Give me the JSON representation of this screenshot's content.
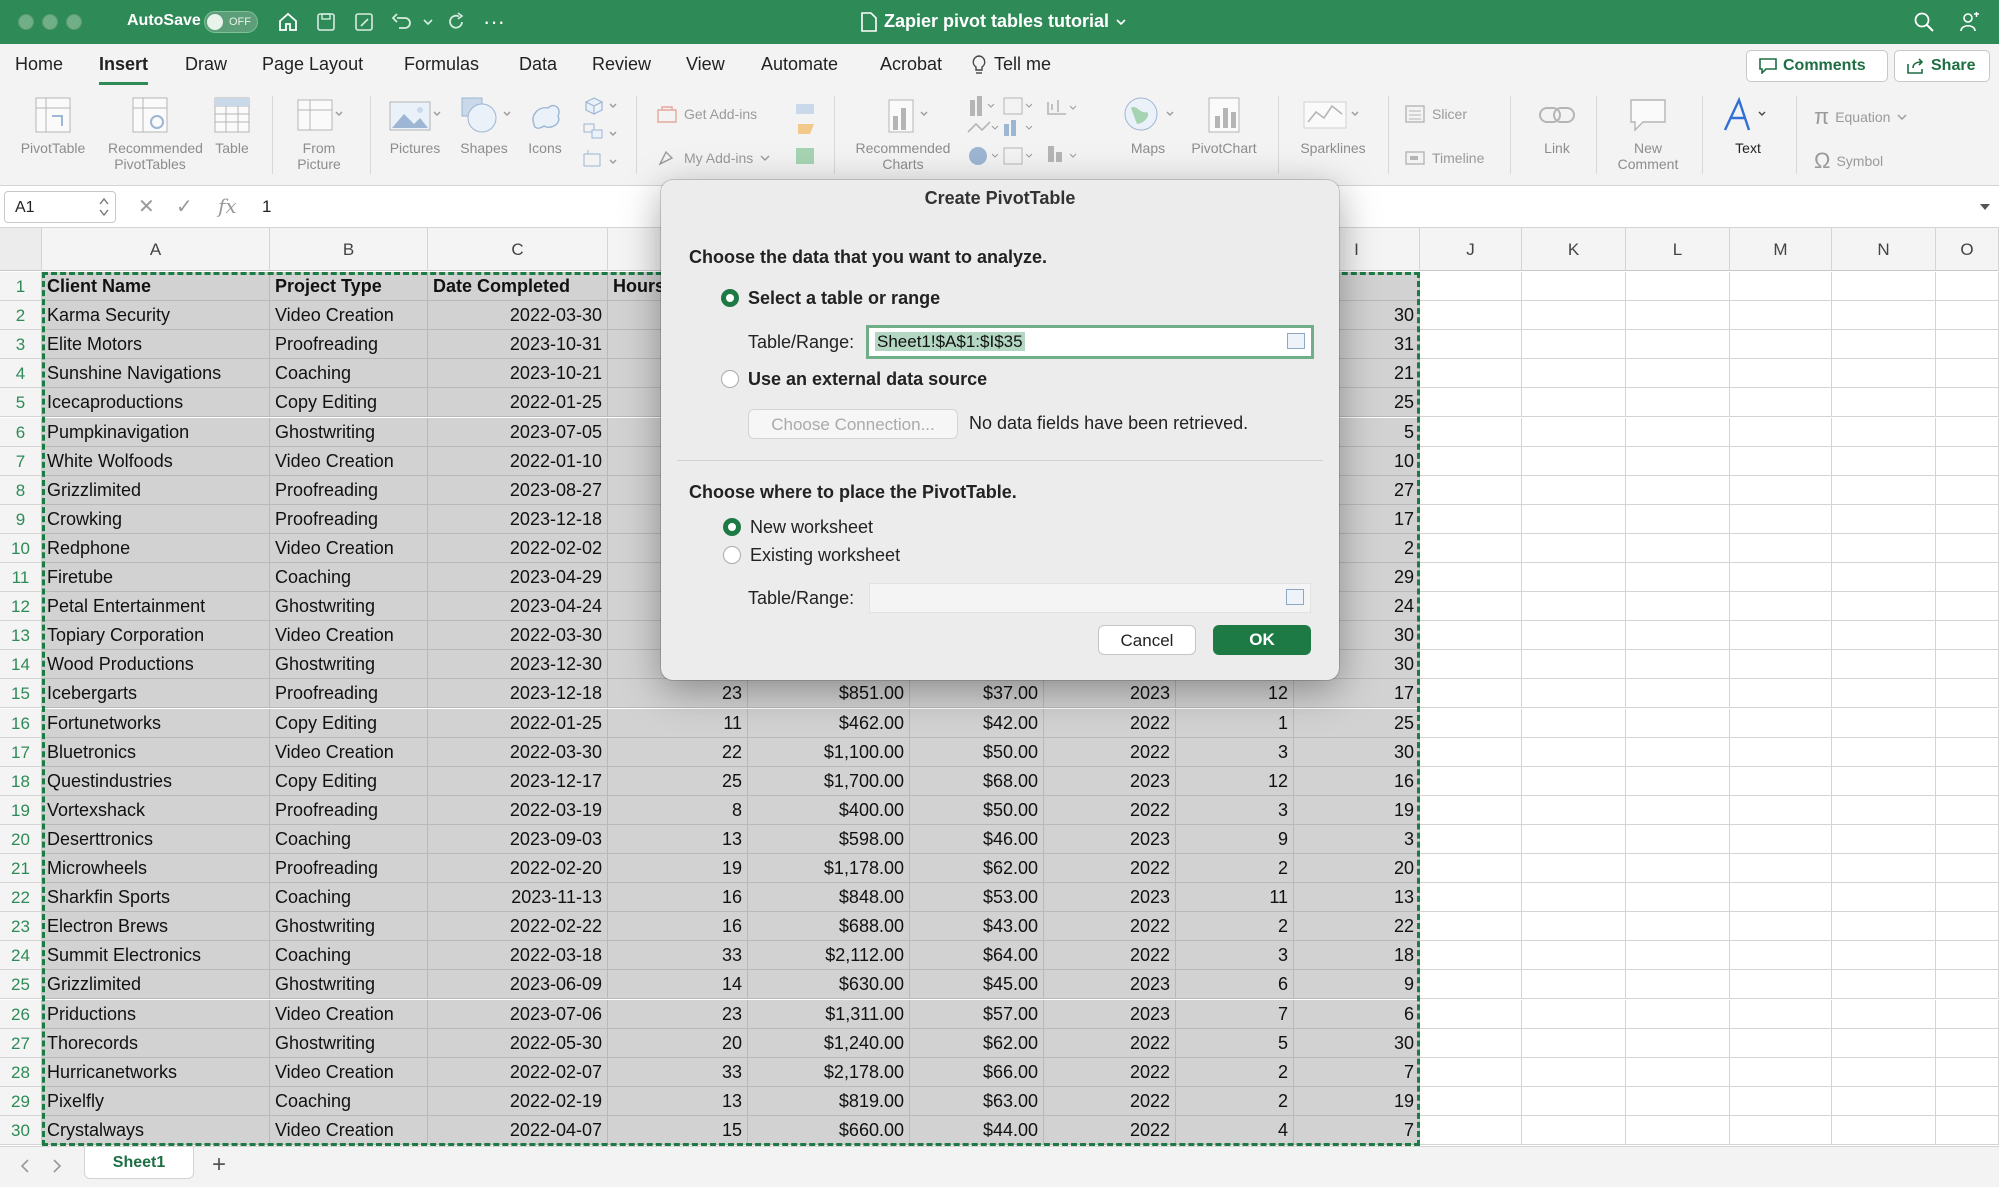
{
  "titlebar": {
    "autosave_label": "AutoSave",
    "autosave_state": "OFF",
    "doc_title": "Zapier pivot tables tutorial"
  },
  "tabs": [
    "Home",
    "Insert",
    "Draw",
    "Page Layout",
    "Formulas",
    "Data",
    "Review",
    "View",
    "Automate",
    "Acrobat",
    "Tell me"
  ],
  "active_tab": "Insert",
  "top_buttons": {
    "comments": "Comments",
    "share": "Share"
  },
  "ribbon": {
    "pivottable": "PivotTable",
    "recommended_pivot_1": "Recommended",
    "recommended_pivot_2": "PivotTables",
    "table": "Table",
    "from_picture_1": "From",
    "from_picture_2": "Picture",
    "pictures": "Pictures",
    "shapes": "Shapes",
    "icons": "Icons",
    "get_addins": "Get Add-ins",
    "my_addins": "My Add-ins",
    "recommended_charts_1": "Recommended",
    "recommended_charts_2": "Charts",
    "maps": "Maps",
    "pivotchart": "PivotChart",
    "sparklines": "Sparklines",
    "slicer": "Slicer",
    "timeline": "Timeline",
    "link": "Link",
    "new_comment_1": "New",
    "new_comment_2": "Comment",
    "text": "Text",
    "equation": "Equation",
    "symbol": "Symbol"
  },
  "formula_bar": {
    "name_box": "A1",
    "fx": "fx",
    "value": "1"
  },
  "columns": [
    "A",
    "B",
    "C",
    "I",
    "J",
    "K",
    "L",
    "M",
    "N",
    "O"
  ],
  "rows": [
    {
      "n": "1",
      "a": "Client Name",
      "b": "Project Type",
      "c": "Date Completed",
      "d": "Hours",
      "e": "",
      "f": "",
      "g": "",
      "h": "",
      "i": ""
    },
    {
      "n": "2",
      "a": "Karma Security",
      "b": "Video Creation",
      "c": "2022-03-30",
      "d": "",
      "e": "",
      "f": "",
      "g": "",
      "h": "",
      "i": "30"
    },
    {
      "n": "3",
      "a": "Elite Motors",
      "b": "Proofreading",
      "c": "2023-10-31",
      "d": "",
      "e": "",
      "f": "",
      "g": "",
      "h": "",
      "i": "31"
    },
    {
      "n": "4",
      "a": "Sunshine Navigations",
      "b": "Coaching",
      "c": "2023-10-21",
      "d": "",
      "e": "",
      "f": "",
      "g": "",
      "h": "",
      "i": "21"
    },
    {
      "n": "5",
      "a": "Icecaproductions",
      "b": "Copy Editing",
      "c": "2022-01-25",
      "d": "",
      "e": "",
      "f": "",
      "g": "",
      "h": "",
      "i": "25"
    },
    {
      "n": "6",
      "a": "Pumpkinavigation",
      "b": "Ghostwriting",
      "c": "2023-07-05",
      "d": "",
      "e": "",
      "f": "",
      "g": "",
      "h": "",
      "i": "5"
    },
    {
      "n": "7",
      "a": "White Wolfoods",
      "b": "Video Creation",
      "c": "2022-01-10",
      "d": "",
      "e": "",
      "f": "",
      "g": "",
      "h": "",
      "i": "10"
    },
    {
      "n": "8",
      "a": "Grizzlimited",
      "b": "Proofreading",
      "c": "2023-08-27",
      "d": "",
      "e": "",
      "f": "",
      "g": "",
      "h": "",
      "i": "27"
    },
    {
      "n": "9",
      "a": "Crowking",
      "b": "Proofreading",
      "c": "2023-12-18",
      "d": "",
      "e": "",
      "f": "",
      "g": "",
      "h": "",
      "i": "17"
    },
    {
      "n": "10",
      "a": "Redphone",
      "b": "Video Creation",
      "c": "2022-02-02",
      "d": "",
      "e": "",
      "f": "",
      "g": "",
      "h": "",
      "i": "2"
    },
    {
      "n": "11",
      "a": "Firetube",
      "b": "Coaching",
      "c": "2023-04-29",
      "d": "",
      "e": "",
      "f": "",
      "g": "",
      "h": "",
      "i": "29"
    },
    {
      "n": "12",
      "a": "Petal Entertainment",
      "b": "Ghostwriting",
      "c": "2023-04-24",
      "d": "",
      "e": "",
      "f": "",
      "g": "",
      "h": "",
      "i": "24"
    },
    {
      "n": "13",
      "a": "Topiary Corporation",
      "b": "Video Creation",
      "c": "2022-03-30",
      "d": "",
      "e": "",
      "f": "",
      "g": "",
      "h": "",
      "i": "30"
    },
    {
      "n": "14",
      "a": "Wood Productions",
      "b": "Ghostwriting",
      "c": "2023-12-30",
      "d": "",
      "e": "",
      "f": "",
      "g": "",
      "h": "",
      "i": "30"
    },
    {
      "n": "15",
      "a": "Icebergarts",
      "b": "Proofreading",
      "c": "2023-12-18",
      "d": "23",
      "e": "$851.00",
      "f": "$37.00",
      "g": "2023",
      "h": "12",
      "i": "17"
    },
    {
      "n": "16",
      "a": "Fortunetworks",
      "b": "Copy Editing",
      "c": "2022-01-25",
      "d": "11",
      "e": "$462.00",
      "f": "$42.00",
      "g": "2022",
      "h": "1",
      "i": "25"
    },
    {
      "n": "17",
      "a": "Bluetronics",
      "b": "Video Creation",
      "c": "2022-03-30",
      "d": "22",
      "e": "$1,100.00",
      "f": "$50.00",
      "g": "2022",
      "h": "3",
      "i": "30"
    },
    {
      "n": "18",
      "a": "Questindustries",
      "b": "Copy Editing",
      "c": "2023-12-17",
      "d": "25",
      "e": "$1,700.00",
      "f": "$68.00",
      "g": "2023",
      "h": "12",
      "i": "16"
    },
    {
      "n": "19",
      "a": "Vortexshack",
      "b": "Proofreading",
      "c": "2022-03-19",
      "d": "8",
      "e": "$400.00",
      "f": "$50.00",
      "g": "2022",
      "h": "3",
      "i": "19"
    },
    {
      "n": "20",
      "a": "Deserttronics",
      "b": "Coaching",
      "c": "2023-09-03",
      "d": "13",
      "e": "$598.00",
      "f": "$46.00",
      "g": "2023",
      "h": "9",
      "i": "3"
    },
    {
      "n": "21",
      "a": "Microwheels",
      "b": "Proofreading",
      "c": "2022-02-20",
      "d": "19",
      "e": "$1,178.00",
      "f": "$62.00",
      "g": "2022",
      "h": "2",
      "i": "20"
    },
    {
      "n": "22",
      "a": "Sharkfin Sports",
      "b": "Coaching",
      "c": "2023-11-13",
      "d": "16",
      "e": "$848.00",
      "f": "$53.00",
      "g": "2023",
      "h": "11",
      "i": "13"
    },
    {
      "n": "23",
      "a": "Electron Brews",
      "b": "Ghostwriting",
      "c": "2022-02-22",
      "d": "16",
      "e": "$688.00",
      "f": "$43.00",
      "g": "2022",
      "h": "2",
      "i": "22"
    },
    {
      "n": "24",
      "a": "Summit Electronics",
      "b": "Coaching",
      "c": "2022-03-18",
      "d": "33",
      "e": "$2,112.00",
      "f": "$64.00",
      "g": "2022",
      "h": "3",
      "i": "18"
    },
    {
      "n": "25",
      "a": "Grizzlimited",
      "b": "Ghostwriting",
      "c": "2023-06-09",
      "d": "14",
      "e": "$630.00",
      "f": "$45.00",
      "g": "2023",
      "h": "6",
      "i": "9"
    },
    {
      "n": "26",
      "a": "Priductions",
      "b": "Video Creation",
      "c": "2023-07-06",
      "d": "23",
      "e": "$1,311.00",
      "f": "$57.00",
      "g": "2023",
      "h": "7",
      "i": "6"
    },
    {
      "n": "27",
      "a": "Thorecords",
      "b": "Ghostwriting",
      "c": "2022-05-30",
      "d": "20",
      "e": "$1,240.00",
      "f": "$62.00",
      "g": "2022",
      "h": "5",
      "i": "30"
    },
    {
      "n": "28",
      "a": "Hurricanetworks",
      "b": "Video Creation",
      "c": "2022-02-07",
      "d": "33",
      "e": "$2,178.00",
      "f": "$66.00",
      "g": "2022",
      "h": "2",
      "i": "7"
    },
    {
      "n": "29",
      "a": "Pixelfly",
      "b": "Coaching",
      "c": "2022-02-19",
      "d": "13",
      "e": "$819.00",
      "f": "$63.00",
      "g": "2022",
      "h": "2",
      "i": "19"
    },
    {
      "n": "30",
      "a": "Crystalways",
      "b": "Video Creation",
      "c": "2022-04-07",
      "d": "15",
      "e": "$660.00",
      "f": "$44.00",
      "g": "2022",
      "h": "4",
      "i": "7"
    }
  ],
  "sheet_tab": "Sheet1",
  "dialog": {
    "title": "Create PivotTable",
    "section1": "Choose the data that you want to analyze.",
    "opt_table": "Select a table or range",
    "table_range_label": "Table/Range:",
    "table_range_value": "Sheet1!$A$1:$I$35",
    "opt_external": "Use an external data source",
    "choose_connection": "Choose Connection...",
    "no_fields": "No data fields have been retrieved.",
    "section2": "Choose where to place the PivotTable.",
    "opt_new": "New worksheet",
    "opt_existing": "Existing worksheet",
    "table_range_label2": "Table/Range:",
    "cancel": "Cancel",
    "ok": "OK"
  },
  "colors": {
    "accent": "#2e8b57",
    "selection": "#d2d2d2",
    "marquee": "#1e7a45"
  }
}
